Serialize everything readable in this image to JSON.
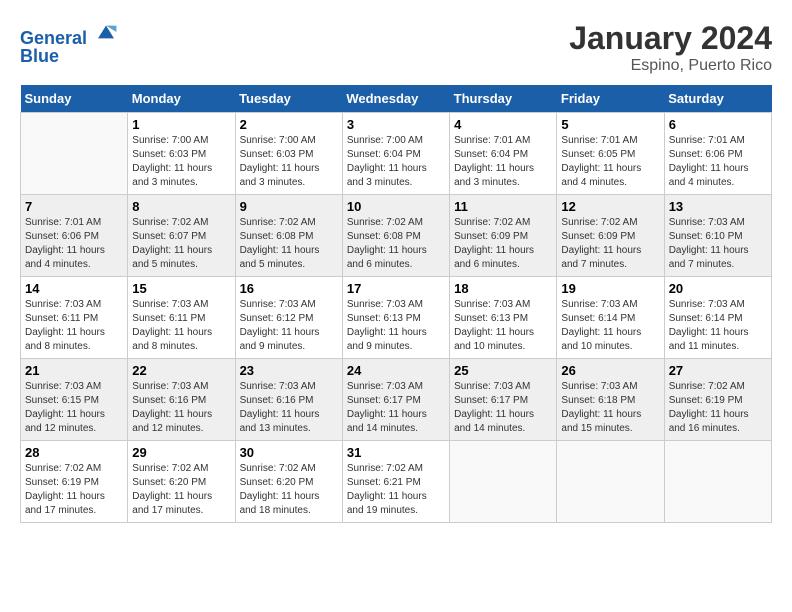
{
  "logo": {
    "line1": "General",
    "line2": "Blue"
  },
  "title": "January 2024",
  "subtitle": "Espino, Puerto Rico",
  "days_of_week": [
    "Sunday",
    "Monday",
    "Tuesday",
    "Wednesday",
    "Thursday",
    "Friday",
    "Saturday"
  ],
  "weeks": [
    [
      {
        "day": "",
        "info": ""
      },
      {
        "day": "1",
        "info": "Sunrise: 7:00 AM\nSunset: 6:03 PM\nDaylight: 11 hours\nand 3 minutes."
      },
      {
        "day": "2",
        "info": "Sunrise: 7:00 AM\nSunset: 6:03 PM\nDaylight: 11 hours\nand 3 minutes."
      },
      {
        "day": "3",
        "info": "Sunrise: 7:00 AM\nSunset: 6:04 PM\nDaylight: 11 hours\nand 3 minutes."
      },
      {
        "day": "4",
        "info": "Sunrise: 7:01 AM\nSunset: 6:04 PM\nDaylight: 11 hours\nand 3 minutes."
      },
      {
        "day": "5",
        "info": "Sunrise: 7:01 AM\nSunset: 6:05 PM\nDaylight: 11 hours\nand 4 minutes."
      },
      {
        "day": "6",
        "info": "Sunrise: 7:01 AM\nSunset: 6:06 PM\nDaylight: 11 hours\nand 4 minutes."
      }
    ],
    [
      {
        "day": "7",
        "info": "Sunrise: 7:01 AM\nSunset: 6:06 PM\nDaylight: 11 hours\nand 4 minutes."
      },
      {
        "day": "8",
        "info": "Sunrise: 7:02 AM\nSunset: 6:07 PM\nDaylight: 11 hours\nand 5 minutes."
      },
      {
        "day": "9",
        "info": "Sunrise: 7:02 AM\nSunset: 6:08 PM\nDaylight: 11 hours\nand 5 minutes."
      },
      {
        "day": "10",
        "info": "Sunrise: 7:02 AM\nSunset: 6:08 PM\nDaylight: 11 hours\nand 6 minutes."
      },
      {
        "day": "11",
        "info": "Sunrise: 7:02 AM\nSunset: 6:09 PM\nDaylight: 11 hours\nand 6 minutes."
      },
      {
        "day": "12",
        "info": "Sunrise: 7:02 AM\nSunset: 6:09 PM\nDaylight: 11 hours\nand 7 minutes."
      },
      {
        "day": "13",
        "info": "Sunrise: 7:03 AM\nSunset: 6:10 PM\nDaylight: 11 hours\nand 7 minutes."
      }
    ],
    [
      {
        "day": "14",
        "info": "Sunrise: 7:03 AM\nSunset: 6:11 PM\nDaylight: 11 hours\nand 8 minutes."
      },
      {
        "day": "15",
        "info": "Sunrise: 7:03 AM\nSunset: 6:11 PM\nDaylight: 11 hours\nand 8 minutes."
      },
      {
        "day": "16",
        "info": "Sunrise: 7:03 AM\nSunset: 6:12 PM\nDaylight: 11 hours\nand 9 minutes."
      },
      {
        "day": "17",
        "info": "Sunrise: 7:03 AM\nSunset: 6:13 PM\nDaylight: 11 hours\nand 9 minutes."
      },
      {
        "day": "18",
        "info": "Sunrise: 7:03 AM\nSunset: 6:13 PM\nDaylight: 11 hours\nand 10 minutes."
      },
      {
        "day": "19",
        "info": "Sunrise: 7:03 AM\nSunset: 6:14 PM\nDaylight: 11 hours\nand 10 minutes."
      },
      {
        "day": "20",
        "info": "Sunrise: 7:03 AM\nSunset: 6:14 PM\nDaylight: 11 hours\nand 11 minutes."
      }
    ],
    [
      {
        "day": "21",
        "info": "Sunrise: 7:03 AM\nSunset: 6:15 PM\nDaylight: 11 hours\nand 12 minutes."
      },
      {
        "day": "22",
        "info": "Sunrise: 7:03 AM\nSunset: 6:16 PM\nDaylight: 11 hours\nand 12 minutes."
      },
      {
        "day": "23",
        "info": "Sunrise: 7:03 AM\nSunset: 6:16 PM\nDaylight: 11 hours\nand 13 minutes."
      },
      {
        "day": "24",
        "info": "Sunrise: 7:03 AM\nSunset: 6:17 PM\nDaylight: 11 hours\nand 14 minutes."
      },
      {
        "day": "25",
        "info": "Sunrise: 7:03 AM\nSunset: 6:17 PM\nDaylight: 11 hours\nand 14 minutes."
      },
      {
        "day": "26",
        "info": "Sunrise: 7:03 AM\nSunset: 6:18 PM\nDaylight: 11 hours\nand 15 minutes."
      },
      {
        "day": "27",
        "info": "Sunrise: 7:02 AM\nSunset: 6:19 PM\nDaylight: 11 hours\nand 16 minutes."
      }
    ],
    [
      {
        "day": "28",
        "info": "Sunrise: 7:02 AM\nSunset: 6:19 PM\nDaylight: 11 hours\nand 17 minutes."
      },
      {
        "day": "29",
        "info": "Sunrise: 7:02 AM\nSunset: 6:20 PM\nDaylight: 11 hours\nand 17 minutes."
      },
      {
        "day": "30",
        "info": "Sunrise: 7:02 AM\nSunset: 6:20 PM\nDaylight: 11 hours\nand 18 minutes."
      },
      {
        "day": "31",
        "info": "Sunrise: 7:02 AM\nSunset: 6:21 PM\nDaylight: 11 hours\nand 19 minutes."
      },
      {
        "day": "",
        "info": ""
      },
      {
        "day": "",
        "info": ""
      },
      {
        "day": "",
        "info": ""
      }
    ]
  ]
}
